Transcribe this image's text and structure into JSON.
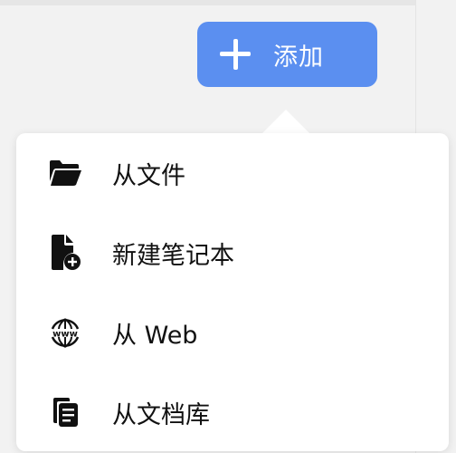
{
  "add_button": {
    "label": "添加",
    "icon": "plus-icon",
    "color": "#5b8ff0"
  },
  "menu": {
    "items": [
      {
        "label": "从文件",
        "icon": "folder-open-icon"
      },
      {
        "label": "新建笔记本",
        "icon": "file-add-icon"
      },
      {
        "label": "从 Web",
        "icon": "www-globe-icon"
      },
      {
        "label": "从文档库",
        "icon": "library-copy-icon"
      }
    ]
  }
}
